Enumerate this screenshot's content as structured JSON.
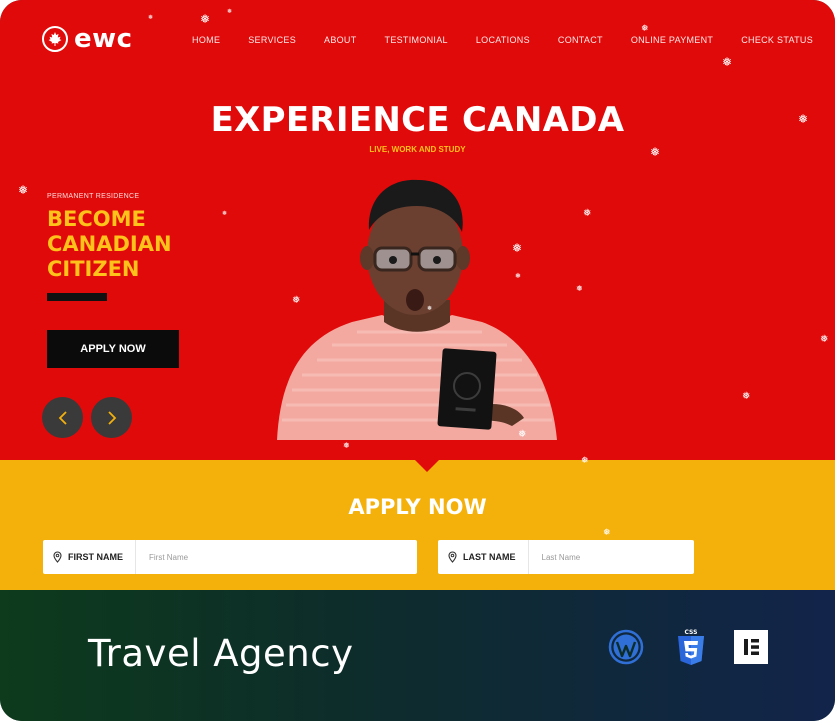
{
  "brand": {
    "logo_text": "ewc",
    "logo_icon": "maple-leaf-icon"
  },
  "nav": {
    "items": [
      {
        "label": "HOME"
      },
      {
        "label": "SERVICES"
      },
      {
        "label": "ABOUT"
      },
      {
        "label": "TESTIMONIAL"
      },
      {
        "label": "LOCATIONS"
      },
      {
        "label": "CONTACT"
      },
      {
        "label": "ONLINE PAYMENT"
      },
      {
        "label": "CHECK STATUS"
      }
    ]
  },
  "hero": {
    "title": "EXPERIENCE CANADA",
    "subtitle": "LIVE, WORK AND STUDY",
    "eyebrow": "PERMANENT RESIDENCE",
    "headline_lines": [
      "BECOME",
      "CANADIAN",
      "CITIZEN"
    ],
    "cta_label": "APPLY NOW",
    "prev_icon": "chevron-left-icon",
    "next_icon": "chevron-right-icon"
  },
  "form": {
    "title": "APPLY NOW",
    "first_name": {
      "label": "FIRST NAME",
      "placeholder": "First Name",
      "icon": "map-pin-icon"
    },
    "last_name": {
      "label": "LAST NAME",
      "placeholder": "Last Name",
      "icon": "map-pin-icon"
    }
  },
  "footer": {
    "title": "Travel Agency",
    "icons": [
      "wordpress-icon",
      "css3-icon",
      "elementor-icon"
    ],
    "css_badge_text": "CSS"
  },
  "colors": {
    "hero_red": "#e10a0a",
    "accent_yellow": "#ffc21a",
    "form_bg": "#f4b10c",
    "button_black": "#0b0b0b"
  }
}
